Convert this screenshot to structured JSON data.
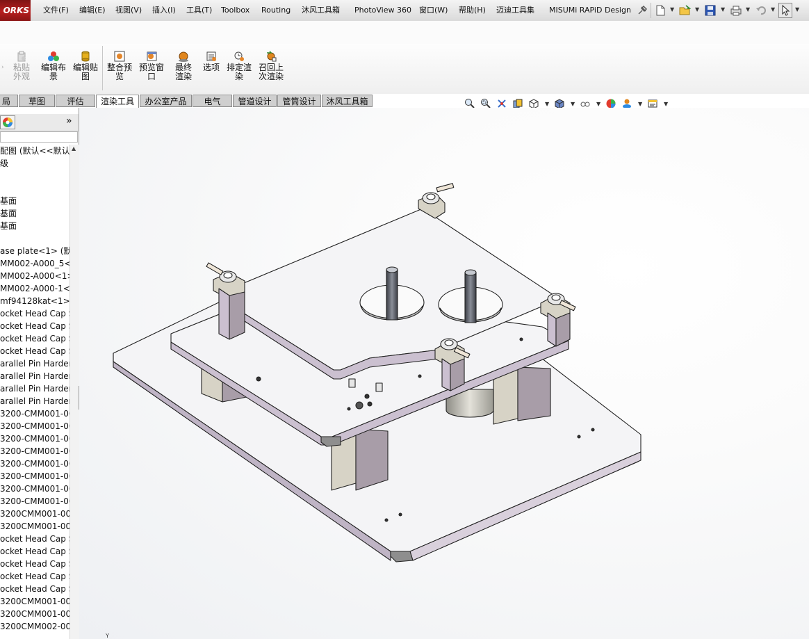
{
  "app": {
    "logo_text": "ORKS",
    "menu": [
      {
        "label": "文件(F)"
      },
      {
        "label": "编辑(E)"
      },
      {
        "label": "视图(V)"
      },
      {
        "label": "插入(I)"
      },
      {
        "label": "工具(T)"
      },
      {
        "label": "Toolbox"
      },
      {
        "label": "Routing"
      },
      {
        "label": "沐风工具箱"
      },
      {
        "label": "PhotoView 360"
      },
      {
        "label": "窗口(W)"
      },
      {
        "label": "帮助(H)"
      },
      {
        "label": "迈迪工具集"
      },
      {
        "label": "MISUMi RAPiD Design"
      }
    ],
    "quick_access": [
      "pin-icon",
      "new-document-icon",
      "open-folder-icon",
      "save-icon",
      "print-icon",
      "undo-icon",
      "select-cursor-icon"
    ]
  },
  "ribbon": {
    "buttons": [
      {
        "label": "粘贴外观",
        "enabled": false,
        "icon": "paste-appearance-icon"
      },
      {
        "label": "编辑布景",
        "enabled": true,
        "icon": "edit-scene-icon"
      },
      {
        "label": "编辑贴图",
        "enabled": true,
        "icon": "edit-decal-icon"
      },
      {
        "label": "整合预览",
        "enabled": true,
        "icon": "integrated-preview-icon"
      },
      {
        "label": "预览窗口",
        "enabled": true,
        "icon": "preview-window-icon"
      },
      {
        "label": "最终渲染",
        "enabled": true,
        "icon": "final-render-icon"
      },
      {
        "label": "选项",
        "enabled": true,
        "icon": "options-icon"
      },
      {
        "label": "排定渲染",
        "enabled": true,
        "icon": "schedule-render-icon"
      },
      {
        "label": "召回上次渲染",
        "enabled": true,
        "icon": "recall-last-render-icon"
      }
    ]
  },
  "command_tabs": [
    {
      "label": "局",
      "active": false
    },
    {
      "label": "草图",
      "active": false
    },
    {
      "label": "评估",
      "active": false
    },
    {
      "label": "渲染工具",
      "active": true
    },
    {
      "label": "办公室产品",
      "active": false
    },
    {
      "label": "电气",
      "active": false
    },
    {
      "label": "管道设计",
      "active": false
    },
    {
      "label": "管筒设计",
      "active": false
    },
    {
      "label": "沐风工具箱",
      "active": false
    }
  ],
  "view_toolbar": [
    "zoom-to-fit-icon",
    "zoom-area-icon",
    "previous-view-icon",
    "section-view-icon",
    "view-orientation-icon",
    "display-style-icon",
    "hide-show-items-icon",
    "edit-appearance-icon",
    "apply-scene-icon",
    "view-settings-icon"
  ],
  "feature_tree": {
    "expand_label": "»",
    "items": [
      "配图 (默认<<默认",
      "级",
      "",
      "",
      "基面",
      "基面",
      "基面",
      "",
      "ase plate<1> (默",
      "MM002-A000_5<",
      "MM002-A000<1>",
      "MM002-A000-1<",
      "mf94128kat<1> (",
      "ocket Head Cap S",
      "ocket Head Cap S",
      "ocket Head Cap S",
      "ocket Head Cap S",
      "arallel Pin Harder",
      "arallel Pin Harder",
      "arallel Pin Harder",
      "arallel Pin Harder",
      "3200-CMM001-00",
      "3200-CMM001-00",
      "3200-CMM001-00",
      "3200-CMM001-00",
      "3200-CMM001-00",
      "3200-CMM001-00",
      "3200-CMM001-00",
      "3200-CMM001-00",
      "3200CMM001-00",
      "3200CMM001-00",
      "ocket Head Cap S",
      "ocket Head Cap S",
      "ocket Head Cap S",
      "ocket Head Cap S",
      "ocket Head Cap S",
      "3200CMM001-00",
      "3200CMM001-00",
      "3200CMM002-00"
    ]
  },
  "colors": {
    "model_face": "#f4f4f6",
    "model_edge": "#222222",
    "model_side": "#cbc0d0",
    "block_side": "#d7d3c6",
    "block_dark": "#a89da8",
    "post": "#5a5d66",
    "active_tab": "#ffffff",
    "tab": "#cfcfcf"
  }
}
